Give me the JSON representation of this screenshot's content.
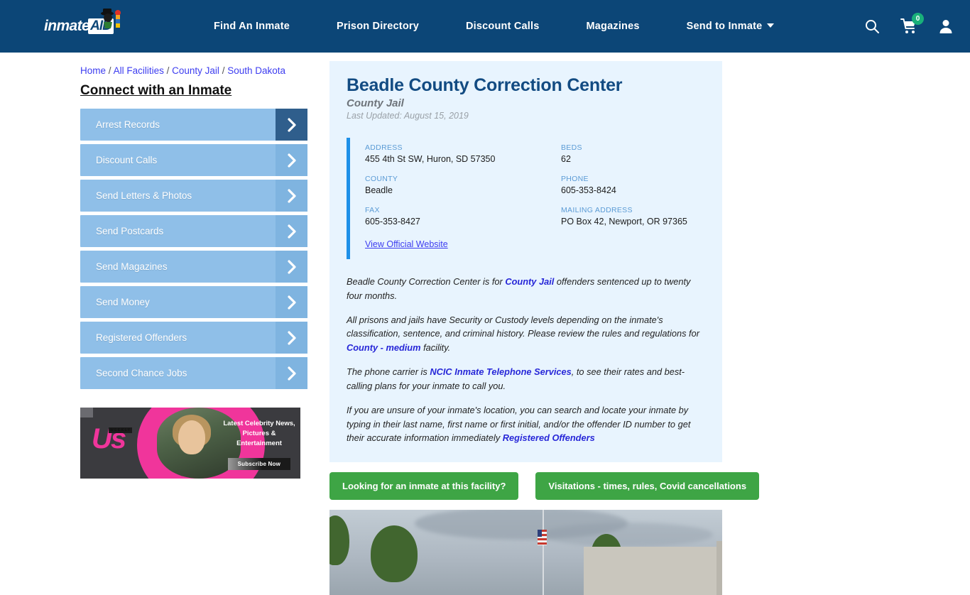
{
  "header": {
    "logo_text": "inmate",
    "logo_badge": "AID",
    "nav": [
      {
        "label": "Find An Inmate",
        "caret": false
      },
      {
        "label": "Prison Directory",
        "caret": false
      },
      {
        "label": "Discount Calls",
        "caret": false
      },
      {
        "label": "Magazines",
        "caret": false
      },
      {
        "label": "Send to Inmate",
        "caret": true
      }
    ],
    "icons": {
      "search": "search-icon",
      "cart": "cart-icon",
      "cart_count": "0",
      "account": "user-icon"
    }
  },
  "breadcrumb": {
    "items": [
      "Home",
      "All Facilities",
      "County Jail",
      "South Dakota"
    ],
    "separator": "/"
  },
  "sidebar": {
    "heading": "Connect with an Inmate",
    "items": [
      {
        "label": "Arrest Records"
      },
      {
        "label": "Discount Calls"
      },
      {
        "label": "Send Letters & Photos"
      },
      {
        "label": "Send Postcards"
      },
      {
        "label": "Send Magazines"
      },
      {
        "label": "Send Money"
      },
      {
        "label": "Registered Offenders"
      },
      {
        "label": "Second Chance Jobs"
      }
    ]
  },
  "ad": {
    "brand": "Us",
    "brand_sub": "WEEKLY",
    "copy": "Latest Celebrity News, Pictures & Entertainment",
    "button": "Subscribe Now"
  },
  "facility": {
    "name": "Beadle County Correction Center",
    "type": "County Jail",
    "last_updated": "Last Updated: August 15, 2019",
    "details": [
      {
        "key": "ADDRESS",
        "value": "455 4th St SW, Huron, SD 57350"
      },
      {
        "key": "BEDS",
        "value": "62"
      },
      {
        "key": "COUNTY",
        "value": "Beadle"
      },
      {
        "key": "PHONE",
        "value": "605-353-8424"
      },
      {
        "key": "FAX",
        "value": "605-353-8427"
      },
      {
        "key": "MAILING ADDRESS",
        "value": "PO Box 42, Newport, OR 97365"
      }
    ],
    "official_website_link": "View Official Website"
  },
  "paragraphs": {
    "p1_a": "Beadle County Correction Center is for ",
    "p1_link": "County Jail",
    "p1_b": " offenders sentenced up to twenty four months.",
    "p2_a": "All prisons and jails have Security or Custody levels depending on the inmate's classification, sentence, and criminal history. Please review the rules and regulations for ",
    "p2_link": "County - medium",
    "p2_b": " facility.",
    "p3_a": "The phone carrier is ",
    "p3_link": "NCIC Inmate Telephone Services",
    "p3_b": ", to see their rates and best-calling plans for your inmate to call you.",
    "p4_a": "If you are unsure of your inmate's location, you can search and locate your inmate by typing in their last name, first name or first initial, and/or the offender ID number to get their accurate information immediately ",
    "p4_link": "Registered Offenders"
  },
  "cta": {
    "inmate_search": "Looking for an inmate at this facility?",
    "visitations": "Visitations - times, rules, Covid cancellations"
  },
  "colors": {
    "header_bg": "#0c4677",
    "card_bg": "#e8f4fe",
    "accent_bar": "#1e90e8",
    "sidebar_btn": "#8fbfe8",
    "sidebar_btn_arrow_active": "#2f5e8c",
    "cta_green": "#3ea545",
    "link_blue": "#2727d8",
    "title_blue": "#124b82",
    "cart_badge_green": "#19b07a",
    "ad_pink": "#f0359b"
  }
}
